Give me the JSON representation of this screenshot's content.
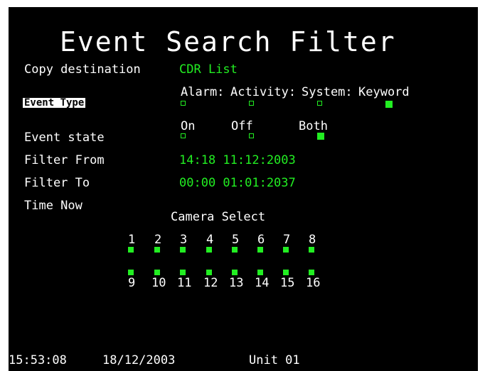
{
  "title": "Event Search Filter",
  "copy_destination": {
    "label": "Copy destination",
    "value": "CDR List"
  },
  "event_type": {
    "label": "Event Type",
    "options": [
      {
        "label": "Alarm:",
        "checked": false
      },
      {
        "label": "Activity:",
        "checked": false
      },
      {
        "label": "System:",
        "checked": false
      },
      {
        "label": "Keyword",
        "checked": true
      }
    ]
  },
  "event_state": {
    "label": "Event state",
    "options": [
      {
        "label": "On",
        "checked": false
      },
      {
        "label": "Off",
        "checked": false
      },
      {
        "label": "Both",
        "checked": true
      }
    ]
  },
  "filter_from": {
    "label": "Filter From",
    "value": "14:18 11:12:2003"
  },
  "filter_to": {
    "label": "Filter To",
    "value": "00:00 01:01:2037"
  },
  "time_now": {
    "label": "Time Now"
  },
  "camera_select": {
    "title": "Camera Select",
    "row1": [
      "1",
      "2",
      "3",
      "4",
      "5",
      "6",
      "7",
      "8"
    ],
    "row2": [
      "9",
      "10",
      "11",
      "12",
      "13",
      "14",
      "15",
      "16"
    ]
  },
  "status_bar": {
    "time": "15:53:08",
    "date": "18/12/2003",
    "unit": "Unit 01"
  },
  "colors": {
    "background": "#000000",
    "text": "#ffffff",
    "accent_green": "#22ee22"
  }
}
